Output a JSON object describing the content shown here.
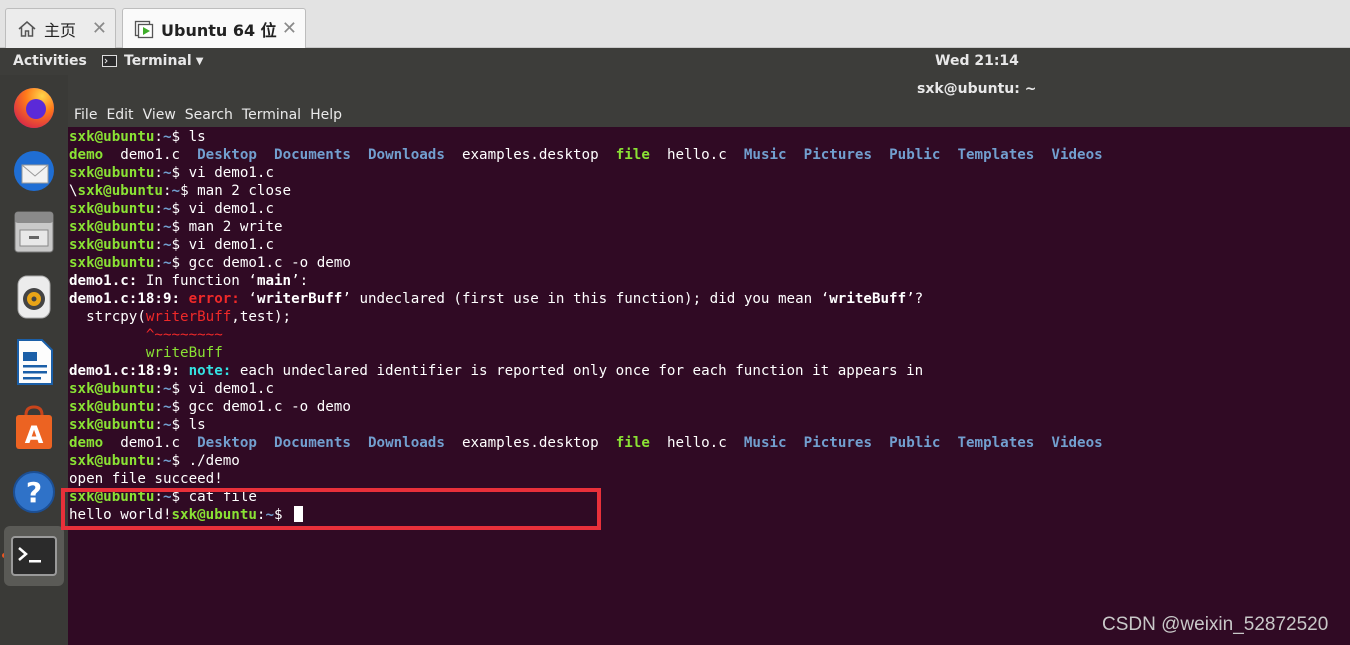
{
  "vmware_tabs": [
    {
      "label": "主页",
      "icon": "home-icon",
      "close": "✕"
    },
    {
      "label": "Ubuntu 64 位",
      "icon": "vm-play-icon",
      "close": "✕"
    }
  ],
  "top_panel": {
    "activities": "Activities",
    "app_menu": "Terminal",
    "clock": "Wed 21:14"
  },
  "dock": [
    {
      "name": "firefox-icon"
    },
    {
      "name": "thunderbird-icon"
    },
    {
      "name": "files-icon"
    },
    {
      "name": "rhythmbox-icon"
    },
    {
      "name": "libreoffice-writer-icon"
    },
    {
      "name": "software-center-icon"
    },
    {
      "name": "help-icon"
    },
    {
      "name": "terminal-icon",
      "active": true
    }
  ],
  "window": {
    "title": "sxk@ubuntu: ~",
    "menu": [
      "File",
      "Edit",
      "View",
      "Search",
      "Terminal",
      "Help"
    ]
  },
  "terminal": {
    "lines": [
      [
        {
          "t": "sxk@ubuntu",
          "c": "p-user"
        },
        {
          "t": ":"
        },
        {
          "t": "~",
          "c": "p-path"
        },
        {
          "t": "$ ls"
        }
      ],
      [
        {
          "t": "demo",
          "c": "exe"
        },
        {
          "t": "  demo1.c  "
        },
        {
          "t": "Desktop",
          "c": "dir"
        },
        {
          "t": "  "
        },
        {
          "t": "Documents",
          "c": "dir"
        },
        {
          "t": "  "
        },
        {
          "t": "Downloads",
          "c": "dir"
        },
        {
          "t": "  examples.desktop  "
        },
        {
          "t": "file",
          "c": "exe"
        },
        {
          "t": "  hello.c  "
        },
        {
          "t": "Music",
          "c": "dir"
        },
        {
          "t": "  "
        },
        {
          "t": "Pictures",
          "c": "dir"
        },
        {
          "t": "  "
        },
        {
          "t": "Public",
          "c": "dir"
        },
        {
          "t": "  "
        },
        {
          "t": "Templates",
          "c": "dir"
        },
        {
          "t": "  "
        },
        {
          "t": "Videos",
          "c": "dir"
        }
      ],
      [
        {
          "t": "sxk@ubuntu",
          "c": "p-user"
        },
        {
          "t": ":"
        },
        {
          "t": "~",
          "c": "p-path"
        },
        {
          "t": "$ vi demo1.c"
        }
      ],
      [
        {
          "t": "\\"
        },
        {
          "t": "sxk@ubuntu",
          "c": "p-user"
        },
        {
          "t": ":"
        },
        {
          "t": "~",
          "c": "p-path"
        },
        {
          "t": "$ man 2 close"
        }
      ],
      [
        {
          "t": "sxk@ubuntu",
          "c": "p-user"
        },
        {
          "t": ":"
        },
        {
          "t": "~",
          "c": "p-path"
        },
        {
          "t": "$ vi demo1.c"
        }
      ],
      [
        {
          "t": "sxk@ubuntu",
          "c": "p-user"
        },
        {
          "t": ":"
        },
        {
          "t": "~",
          "c": "p-path"
        },
        {
          "t": "$ man 2 write"
        }
      ],
      [
        {
          "t": "sxk@ubuntu",
          "c": "p-user"
        },
        {
          "t": ":"
        },
        {
          "t": "~",
          "c": "p-path"
        },
        {
          "t": "$ vi demo1.c"
        }
      ],
      [
        {
          "t": "sxk@ubuntu",
          "c": "p-user"
        },
        {
          "t": ":"
        },
        {
          "t": "~",
          "c": "p-path"
        },
        {
          "t": "$ gcc demo1.c -o demo"
        }
      ],
      [
        {
          "t": "demo1.c:",
          "c": "b"
        },
        {
          "t": " In function ‘"
        },
        {
          "t": "main",
          "c": "b"
        },
        {
          "t": "’:"
        }
      ],
      [
        {
          "t": "demo1.c:18:9:",
          "c": "b"
        },
        {
          "t": " "
        },
        {
          "t": "error:",
          "c": "err"
        },
        {
          "t": " ‘"
        },
        {
          "t": "writerBuff",
          "c": "b"
        },
        {
          "t": "’ undeclared (first use in this function); did you mean ‘"
        },
        {
          "t": "writeBuff",
          "c": "b"
        },
        {
          "t": "’?"
        }
      ],
      [
        {
          "t": "  strcpy("
        },
        {
          "t": "writerBuff",
          "c": "red"
        },
        {
          "t": ",test);"
        }
      ],
      [
        {
          "t": "         ^~~~~~~~~",
          "c": "red"
        }
      ],
      [
        {
          "t": "         writeBuff",
          "c": "green"
        }
      ],
      [
        {
          "t": "demo1.c:18:9:",
          "c": "b"
        },
        {
          "t": " "
        },
        {
          "t": "note:",
          "c": "note"
        },
        {
          "t": " each undeclared identifier is reported only once for each function it appears in"
        }
      ],
      [
        {
          "t": "sxk@ubuntu",
          "c": "p-user"
        },
        {
          "t": ":"
        },
        {
          "t": "~",
          "c": "p-path"
        },
        {
          "t": "$ vi demo1.c"
        }
      ],
      [
        {
          "t": "sxk@ubuntu",
          "c": "p-user"
        },
        {
          "t": ":"
        },
        {
          "t": "~",
          "c": "p-path"
        },
        {
          "t": "$ gcc demo1.c -o demo"
        }
      ],
      [
        {
          "t": "sxk@ubuntu",
          "c": "p-user"
        },
        {
          "t": ":"
        },
        {
          "t": "~",
          "c": "p-path"
        },
        {
          "t": "$ ls"
        }
      ],
      [
        {
          "t": "demo",
          "c": "exe"
        },
        {
          "t": "  demo1.c  "
        },
        {
          "t": "Desktop",
          "c": "dir"
        },
        {
          "t": "  "
        },
        {
          "t": "Documents",
          "c": "dir"
        },
        {
          "t": "  "
        },
        {
          "t": "Downloads",
          "c": "dir"
        },
        {
          "t": "  examples.desktop  "
        },
        {
          "t": "file",
          "c": "exe"
        },
        {
          "t": "  hello.c  "
        },
        {
          "t": "Music",
          "c": "dir"
        },
        {
          "t": "  "
        },
        {
          "t": "Pictures",
          "c": "dir"
        },
        {
          "t": "  "
        },
        {
          "t": "Public",
          "c": "dir"
        },
        {
          "t": "  "
        },
        {
          "t": "Templates",
          "c": "dir"
        },
        {
          "t": "  "
        },
        {
          "t": "Videos",
          "c": "dir"
        }
      ],
      [
        {
          "t": "sxk@ubuntu",
          "c": "p-user"
        },
        {
          "t": ":"
        },
        {
          "t": "~",
          "c": "p-path"
        },
        {
          "t": "$ ./demo"
        }
      ],
      [
        {
          "t": "open file succeed!"
        }
      ],
      [
        {
          "t": "sxk@ubuntu",
          "c": "p-user"
        },
        {
          "t": ":"
        },
        {
          "t": "~",
          "c": "p-path"
        },
        {
          "t": "$ cat file"
        }
      ],
      [
        {
          "t": "hello world!"
        },
        {
          "t": "sxk@ubuntu",
          "c": "p-user"
        },
        {
          "t": ":"
        },
        {
          "t": "~",
          "c": "p-path"
        },
        {
          "t": "$ "
        },
        {
          "cursor": true
        }
      ]
    ]
  },
  "watermark": "CSDN @weixin_52872520",
  "colors": {
    "terminal_bg": "#300a24",
    "prompt_green": "#8ae234",
    "dir_blue": "#729fcf",
    "error_red": "#ef2929",
    "note_cyan": "#34e2e2",
    "highlight_box": "#e8303a"
  }
}
